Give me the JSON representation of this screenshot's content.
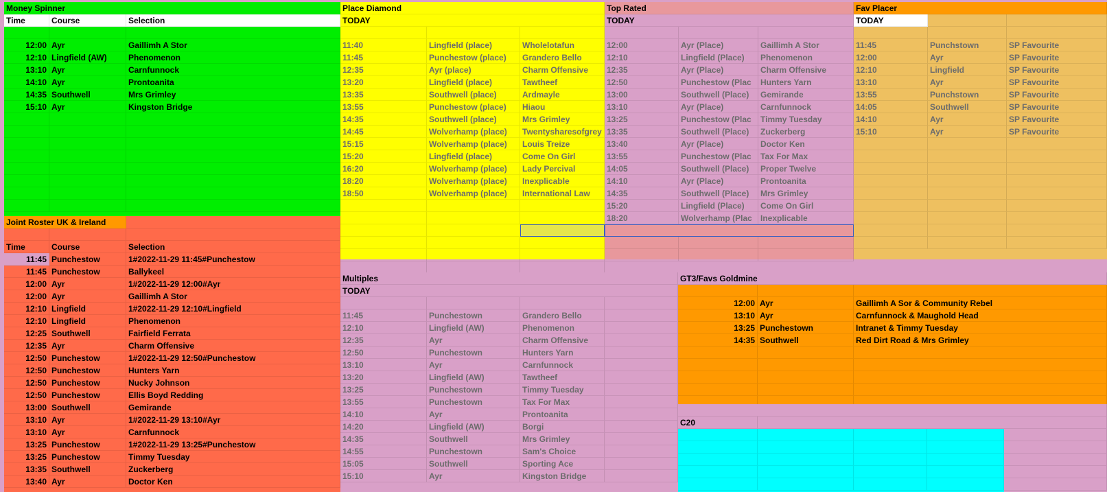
{
  "money_spinner": {
    "title": "Money Spinner",
    "headers": [
      "Time",
      "Course",
      "Selection"
    ],
    "rows": [
      [
        "12:00",
        "Ayr",
        "Gaillimh A Stor"
      ],
      [
        "12:10",
        "Lingfield (AW)",
        "Phenomenon"
      ],
      [
        "13:10",
        "Ayr",
        "Carnfunnock"
      ],
      [
        "14:10",
        "Ayr",
        "Prontoanita"
      ],
      [
        "14:35",
        "Southwell",
        "Mrs Grimley"
      ],
      [
        "15:10",
        "Ayr",
        "Kingston Bridge"
      ]
    ]
  },
  "place_diamond": {
    "title": "Place Diamond",
    "today": "TODAY",
    "rows": [
      [
        "11:40",
        "Lingfield (place)",
        "Wholelotafun"
      ],
      [
        "11:45",
        "Punchestow (place)",
        "Grandero Bello"
      ],
      [
        "12:35",
        "Ayr (place)",
        "Charm Offensive"
      ],
      [
        "13:20",
        "Lingfield (place)",
        "Tawtheef"
      ],
      [
        "13:35",
        "Southwell (place)",
        "Ardmayle"
      ],
      [
        "13:55",
        "Punchestow (place)",
        "Hiaou"
      ],
      [
        "14:35",
        "Southwell (place)",
        "Mrs Grimley"
      ],
      [
        "14:45",
        "Wolverhamp (place)",
        "Twentysharesofgrey"
      ],
      [
        "15:15",
        "Wolverhamp (place)",
        "Louis Treize"
      ],
      [
        "15:20",
        "Lingfield (place)",
        "Come On Girl"
      ],
      [
        "16:20",
        "Wolverhamp (place)",
        "Lady Percival"
      ],
      [
        "18:20",
        "Wolverhamp (place)",
        "Inexplicable"
      ],
      [
        "18:50",
        "Wolverhamp (place)",
        "International Law"
      ]
    ]
  },
  "top_rated": {
    "title": "Top Rated",
    "today": "TODAY",
    "rows": [
      [
        "12:00",
        "Ayr (Place)",
        "Gaillimh A Stor"
      ],
      [
        "12:10",
        "Lingfield (Place)",
        "Phenomenon"
      ],
      [
        "12:35",
        "Ayr (Place)",
        "Charm Offensive"
      ],
      [
        "12:50",
        "Punchestow (Plac",
        "Hunters Yarn"
      ],
      [
        "13:00",
        "Southwell (Place)",
        "Gemirande"
      ],
      [
        "13:10",
        "Ayr (Place)",
        "Carnfunnock"
      ],
      [
        "13:25",
        "Punchestow (Plac",
        "Timmy Tuesday"
      ],
      [
        "13:35",
        "Southwell (Place)",
        "Zuckerberg"
      ],
      [
        "13:40",
        "Ayr (Place)",
        "Doctor Ken"
      ],
      [
        "13:55",
        "Punchestow (Plac",
        "Tax For Max"
      ],
      [
        "14:05",
        "Southwell (Place)",
        "Proper Twelve"
      ],
      [
        "14:10",
        "Ayr (Place)",
        "Prontoanita"
      ],
      [
        "14:35",
        "Southwell (Place)",
        "Mrs Grimley"
      ],
      [
        "15:20",
        "Lingfield (Place)",
        "Come On Girl"
      ],
      [
        "18:20",
        "Wolverhamp (Plac",
        "Inexplicable"
      ]
    ]
  },
  "fav_placer": {
    "title": "Fav Placer",
    "today": "TODAY",
    "rows": [
      [
        "11:45",
        "Punchstown",
        "SP Favourite"
      ],
      [
        "12:00",
        "Ayr",
        "SP Favourite"
      ],
      [
        "12:10",
        "Lingfield",
        "SP Favourite"
      ],
      [
        "13:10",
        "Ayr",
        "SP Favourite"
      ],
      [
        "13:55",
        "Punchstown",
        "SP Favourite"
      ],
      [
        "14:05",
        "Southwell",
        "SP Favourite"
      ],
      [
        "14:10",
        "Ayr",
        "SP Favourite"
      ],
      [
        "15:10",
        "Ayr",
        "SP Favourite"
      ]
    ]
  },
  "joint_roster": {
    "title": "Joint Roster UK & Ireland",
    "headers": [
      "Time",
      "Course",
      "Selection"
    ],
    "rows": [
      [
        "11:45",
        "Punchestow",
        "1#2022-11-29 11:45#Punchestow"
      ],
      [
        "11:45",
        "Punchestow",
        "Ballykeel"
      ],
      [
        "12:00",
        "Ayr",
        "1#2022-11-29 12:00#Ayr"
      ],
      [
        "12:00",
        "Ayr",
        "Gaillimh A Stor"
      ],
      [
        "12:10",
        "Lingfield",
        "1#2022-11-29 12:10#Lingfield"
      ],
      [
        "12:10",
        "Lingfield",
        "Phenomenon"
      ],
      [
        "12:25",
        "Southwell",
        "Fairfield Ferrata"
      ],
      [
        "12:35",
        "Ayr",
        "Charm Offensive"
      ],
      [
        "12:50",
        "Punchestow",
        "1#2022-11-29 12:50#Punchestow"
      ],
      [
        "12:50",
        "Punchestow",
        "Hunters Yarn"
      ],
      [
        "12:50",
        "Punchestow",
        "Nucky Johnson"
      ],
      [
        "12:50",
        "Punchestow",
        "Ellis Boyd Redding"
      ],
      [
        "13:00",
        "Southwell",
        "Gemirande"
      ],
      [
        "13:10",
        "Ayr",
        "1#2022-11-29 13:10#Ayr"
      ],
      [
        "13:10",
        "Ayr",
        "Carnfunnock"
      ],
      [
        "13:25",
        "Punchestow",
        "1#2022-11-29 13:25#Punchestow"
      ],
      [
        "13:25",
        "Punchestow",
        "Timmy Tuesday"
      ],
      [
        "13:35",
        "Southwell",
        "Zuckerberg"
      ],
      [
        "13:40",
        "Ayr",
        "Doctor Ken"
      ]
    ]
  },
  "multiples": {
    "title": "Multiples",
    "today": "TODAY",
    "rows": [
      [
        "11:45",
        "Punchestown",
        "Grandero Bello"
      ],
      [
        "12:10",
        "Lingfield (AW)",
        "Phenomenon"
      ],
      [
        "12:35",
        "Ayr",
        "Charm Offensive"
      ],
      [
        "12:50",
        "Punchestown",
        "Hunters Yarn"
      ],
      [
        "13:10",
        "Ayr",
        "Carnfunnock"
      ],
      [
        "13:20",
        "Lingfield (AW)",
        "Tawtheef"
      ],
      [
        "13:25",
        "Punchestown",
        "Timmy Tuesday"
      ],
      [
        "13:55",
        "Punchestown",
        "Tax For Max"
      ],
      [
        "14:10",
        "Ayr",
        "Prontoanita"
      ],
      [
        "14:20",
        "Lingfield (AW)",
        "Borgi"
      ],
      [
        "14:35",
        "Southwell",
        "Mrs Grimley"
      ],
      [
        "14:55",
        "Punchestown",
        "Sam's Choice"
      ],
      [
        "15:05",
        "Southwell",
        "Sporting Ace"
      ],
      [
        "15:10",
        "Ayr",
        "Kingston Bridge"
      ]
    ]
  },
  "gt3": {
    "title": "GT3/Favs Goldmine",
    "rows": [
      [
        "12:00",
        "Ayr",
        "Gaillimh A Sor & Community Rebel"
      ],
      [
        "13:10",
        "Ayr",
        "Carnfunnock & Maughold Head"
      ],
      [
        "13:25",
        "Punchestown",
        "Intranet & Timmy Tuesday"
      ],
      [
        "14:35",
        "Southwell",
        "Red Dirt Road & Mrs Grimley"
      ]
    ]
  },
  "c20": {
    "title": "C20"
  },
  "colors": {
    "green": "#00ee00",
    "yellow": "#ffff00",
    "pink_header": "#e8989c",
    "lilac": "#d9a0c8",
    "orange": "#ff9900",
    "gold": "#eec060",
    "red_orange": "#ff6a4a",
    "cyan": "#00ffff"
  }
}
